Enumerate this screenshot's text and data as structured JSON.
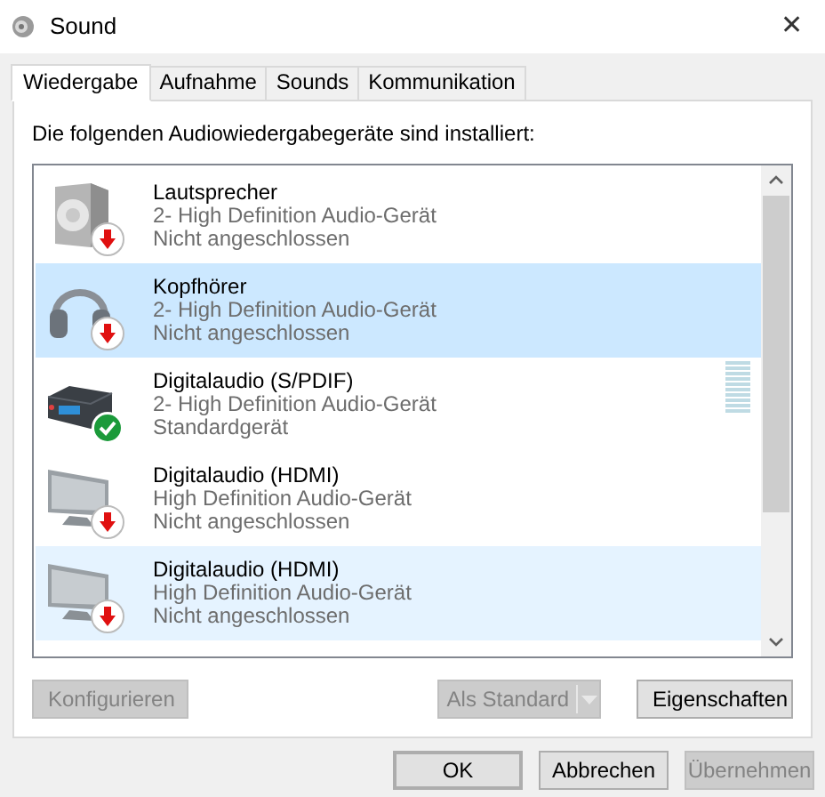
{
  "window": {
    "title": "Sound",
    "close": "✕"
  },
  "tabs": [
    {
      "label": "Wiedergabe",
      "selected": true
    },
    {
      "label": "Aufnahme",
      "selected": false
    },
    {
      "label": "Sounds",
      "selected": false
    },
    {
      "label": "Kommunikation",
      "selected": false
    }
  ],
  "intro": "Die folgenden Audiowiedergabegeräte sind installiert:",
  "devices": [
    {
      "kind": "speaker",
      "name": "Lautsprecher",
      "driver": "2- High Definition Audio-Gerät",
      "status": "Nicht angeschlossen",
      "is_default": false,
      "selected": false,
      "hovered": false
    },
    {
      "kind": "headphones",
      "name": "Kopfhörer",
      "driver": "2- High Definition Audio-Gerät",
      "status": "Nicht angeschlossen",
      "is_default": false,
      "selected": true,
      "hovered": false
    },
    {
      "kind": "receiver",
      "name": "Digitalaudio (S/PDIF)",
      "driver": "2- High Definition Audio-Gerät",
      "status": "Standardgerät",
      "is_default": true,
      "selected": false,
      "hovered": false
    },
    {
      "kind": "monitor",
      "name": "Digitalaudio (HDMI)",
      "driver": "High Definition Audio-Gerät",
      "status": "Nicht angeschlossen",
      "is_default": false,
      "selected": false,
      "hovered": false
    },
    {
      "kind": "monitor",
      "name": "Digitalaudio (HDMI)",
      "driver": "High Definition Audio-Gerät",
      "status": "Nicht angeschlossen",
      "is_default": false,
      "selected": false,
      "hovered": true
    }
  ],
  "panel_buttons": [
    {
      "label": "Konfigurieren",
      "disabled": true,
      "kind": "plain"
    },
    {
      "label": "Als Standard",
      "disabled": true,
      "kind": "split"
    },
    {
      "label": "Eigenschaften",
      "disabled": false,
      "kind": "plain"
    }
  ],
  "dialog_buttons": [
    {
      "label": "OK",
      "disabled": false,
      "default": true
    },
    {
      "label": "Abbrechen",
      "disabled": false,
      "default": false
    },
    {
      "label": "Übernehmen",
      "disabled": true,
      "default": false
    }
  ]
}
